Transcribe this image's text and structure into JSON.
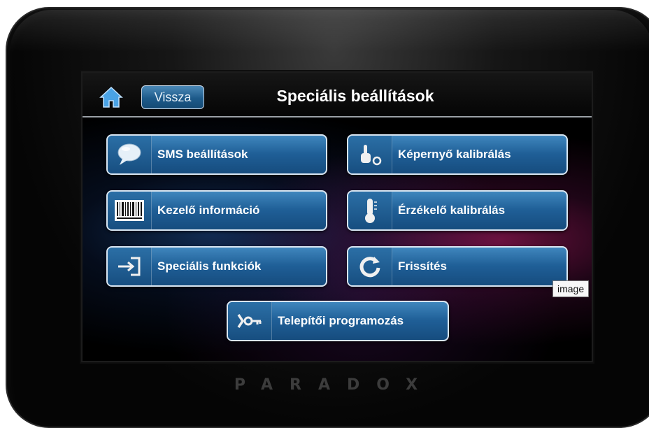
{
  "header": {
    "home_icon": "home-icon",
    "back_label": "Vissza",
    "title": "Speciális beállítások"
  },
  "buttons": [
    {
      "label": "SMS beállítások",
      "icon": "chat-bubble-icon"
    },
    {
      "label": "Képernyő kalibrálás",
      "icon": "touch-calibrate-icon"
    },
    {
      "label": "Kezelő információ",
      "icon": "barcode-icon"
    },
    {
      "label": "Érzékelő kalibrálás",
      "icon": "thermometer-icon"
    },
    {
      "label": "Speciális funkciók",
      "icon": "enter-arrow-icon"
    },
    {
      "label": "Frissítés",
      "icon": "refresh-icon"
    },
    {
      "label": "Telepítői programozás",
      "icon": "installer-key-icon"
    }
  ],
  "brand": "PARADOX",
  "tooltip": "image",
  "colors": {
    "button_blue": "#1f5f97",
    "accent_magenta": "#be1e6e",
    "device_black": "#0a0a0a"
  }
}
